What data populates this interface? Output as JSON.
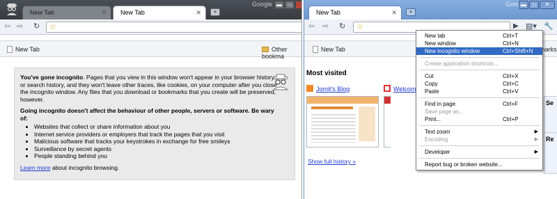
{
  "colors": {
    "incognito_frame": "#4b4f57",
    "normal_frame": "#86aedf",
    "link": "#1b3bd1",
    "menu_highlight": "#316ac5"
  },
  "left": {
    "tabs": [
      {
        "label": "New Tab",
        "active": false
      },
      {
        "label": "New Tab",
        "active": true
      }
    ],
    "google_label": "Google",
    "window_buttons": {
      "minimize": "▬",
      "maximize": "▭",
      "close": "✕"
    },
    "bookmarks": {
      "item1": "New Tab",
      "item2": "Other bookma"
    },
    "incognito": {
      "intro_bold": "You've gone incognito",
      "intro_rest": ". Pages that you view in this window won't appear in your browser history or search history, and they won't leave other traces, like cookies, on your computer after you close the incognito window. Any files that you download or bookmarks that you create will be preserved, however.",
      "warning": "Going incognito doesn't affect the behaviour of other people, servers or software. Be wary of:",
      "bullets": [
        "Websites that collect or share information about you",
        "Internet service providers or employers that track the pages that you visit",
        "Malicious software that tracks your keystrokes in exchange for free smileys",
        "Surveillance by secret agents",
        "People standing behind you"
      ],
      "learn_more": "Learn more",
      "learn_more_rest": " about incognito browsing."
    }
  },
  "right": {
    "tab_label": "New Tab",
    "google_label": "Google",
    "bookmarks": {
      "item1": "New Tab",
      "item2": "marks"
    },
    "most_visited_title": "Most visited",
    "sites": [
      {
        "title": "Jomit's Blog"
      },
      {
        "title": "Welcom"
      }
    ],
    "show_full_history": "Show full history »",
    "side_boxes": [
      "Se",
      "Re"
    ],
    "menu": [
      {
        "label": "New tab",
        "shortcut": "Ctrl+T"
      },
      {
        "label": "New window",
        "shortcut": "Ctrl+N"
      },
      {
        "label": "New incognito window",
        "shortcut": "Ctrl+Shift+N",
        "highlighted": true
      },
      {
        "sep": true
      },
      {
        "label": "Create application shortcuts...",
        "disabled": true
      },
      {
        "sep": true
      },
      {
        "label": "Cut",
        "shortcut": "Ctrl+X"
      },
      {
        "label": "Copy",
        "shortcut": "Ctrl+C"
      },
      {
        "label": "Paste",
        "shortcut": "Ctrl+V"
      },
      {
        "sep": true
      },
      {
        "label": "Find in page",
        "shortcut": "Ctrl+F"
      },
      {
        "label": "Save page as...",
        "disabled": true
      },
      {
        "label": "Print...",
        "shortcut": "Ctrl+P"
      },
      {
        "sep": true
      },
      {
        "label": "Text zoom",
        "submenu": true
      },
      {
        "label": "Encoding",
        "submenu": true,
        "disabled": true
      },
      {
        "sep": true
      },
      {
        "label": "Developer",
        "submenu": true
      },
      {
        "sep": true
      },
      {
        "label": "Report bug or broken website..."
      }
    ]
  }
}
